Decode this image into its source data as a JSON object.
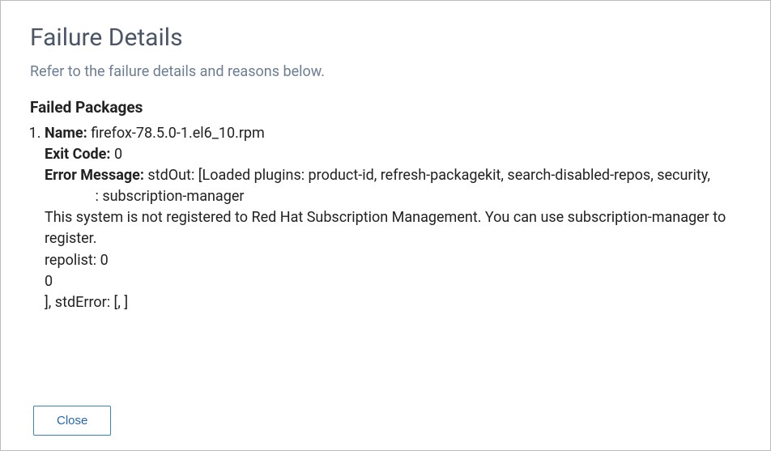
{
  "dialog": {
    "title": "Failure Details",
    "subtitle": "Refer to the failure details and reasons below.",
    "section_heading": "Failed Packages",
    "labels": {
      "name": "Name:  ",
      "exit_code": "Exit Code: ",
      "error_message": "Error Message: "
    },
    "packages": [
      {
        "name": "firefox-78.5.0-1.el6_10.rpm",
        "exit_code": "0",
        "error_line1": "stdOut: [Loaded plugins: product-id, refresh-packagekit, search-disabled-repos, security,",
        "error_line2_indent": "              : ",
        "error_line2": "subscription-manager",
        "error_line3": "This system is not registered to Red Hat Subscription Management. You can use subscription-manager to register.",
        "error_line4": "repolist: 0",
        "error_line5": "0",
        "error_line6": "], stdError: [, ]"
      }
    ],
    "close_label": "Close"
  }
}
